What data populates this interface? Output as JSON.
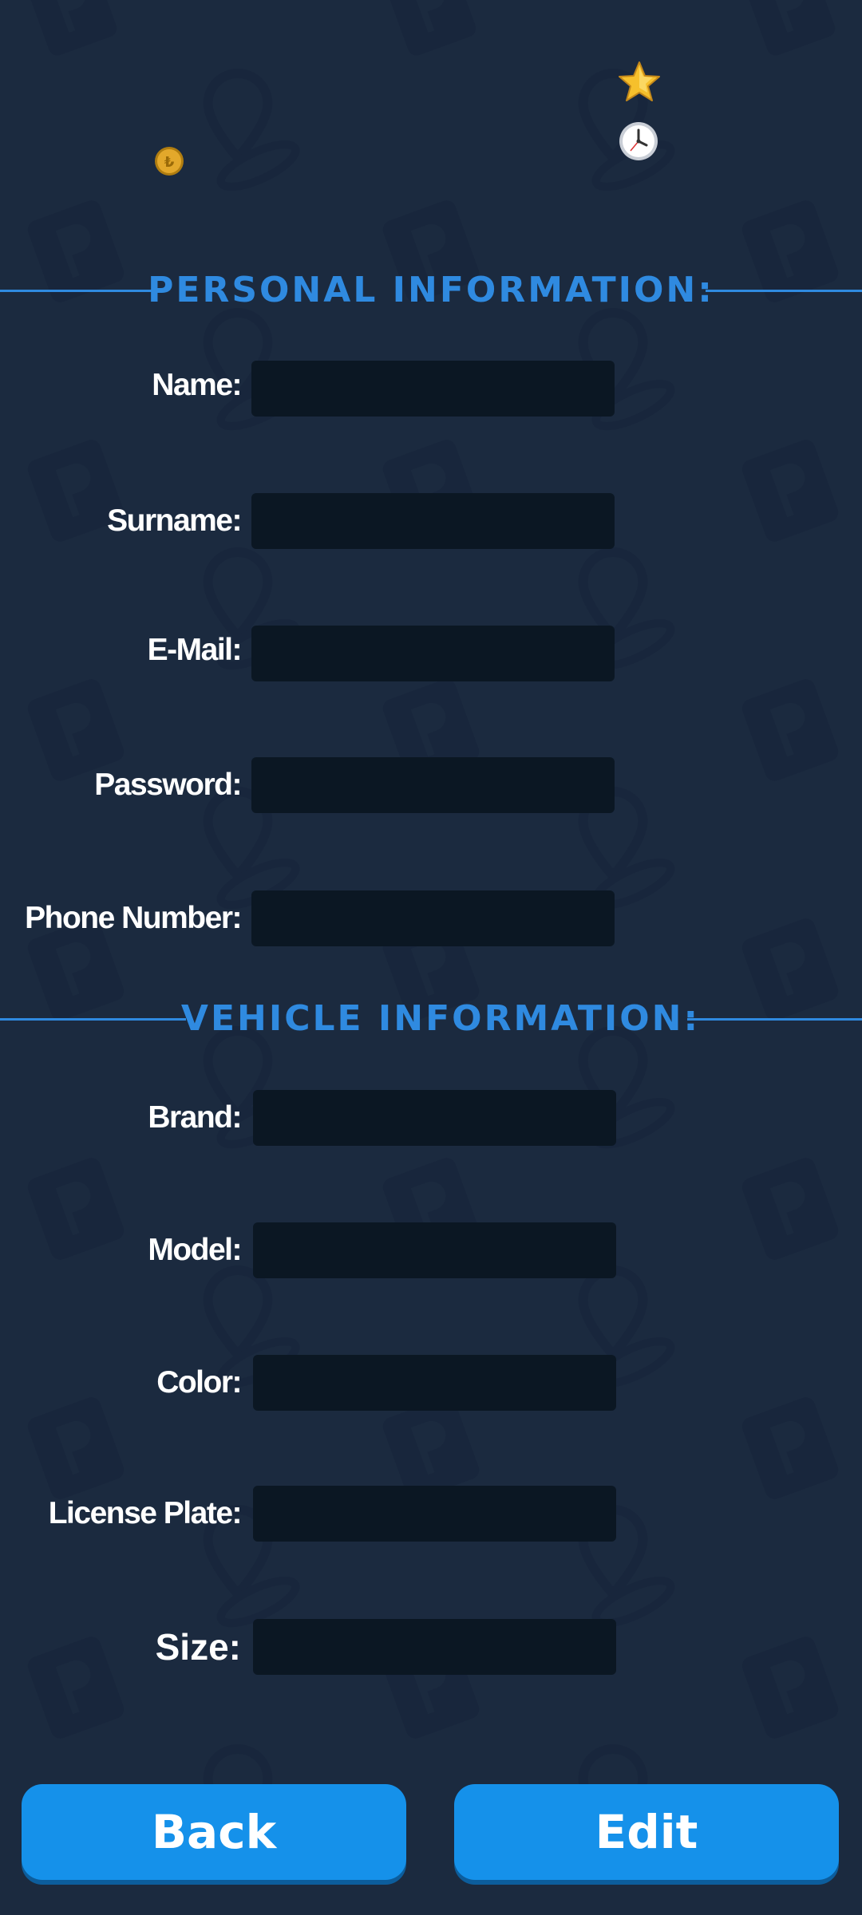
{
  "colors": {
    "background": "#1b2a3f",
    "accent": "#2f8ae0",
    "input_bg": "#0b1723",
    "button_bg": "#1591ea"
  },
  "top_bar": {
    "coin_icon": "coin-icon",
    "star_icon": "star-icon",
    "clock_icon": "clock-icon"
  },
  "personal": {
    "title": "PERSONAL INFORMATION:",
    "fields": [
      {
        "label": "Name:",
        "value": ""
      },
      {
        "label": "Surname:",
        "value": ""
      },
      {
        "label": "E-Mail:",
        "value": ""
      },
      {
        "label": "Password:",
        "value": ""
      },
      {
        "label": "Phone Number:",
        "value": ""
      }
    ]
  },
  "vehicle": {
    "title": "VEHICLE INFORMATION:",
    "fields": [
      {
        "label": "Brand:",
        "value": ""
      },
      {
        "label": "Model:",
        "value": ""
      },
      {
        "label": "Color:",
        "value": ""
      },
      {
        "label": "License Plate:",
        "value": ""
      },
      {
        "label": "Size:",
        "value": ""
      }
    ]
  },
  "actions": {
    "back_label": "Back",
    "edit_label": "Edit"
  }
}
